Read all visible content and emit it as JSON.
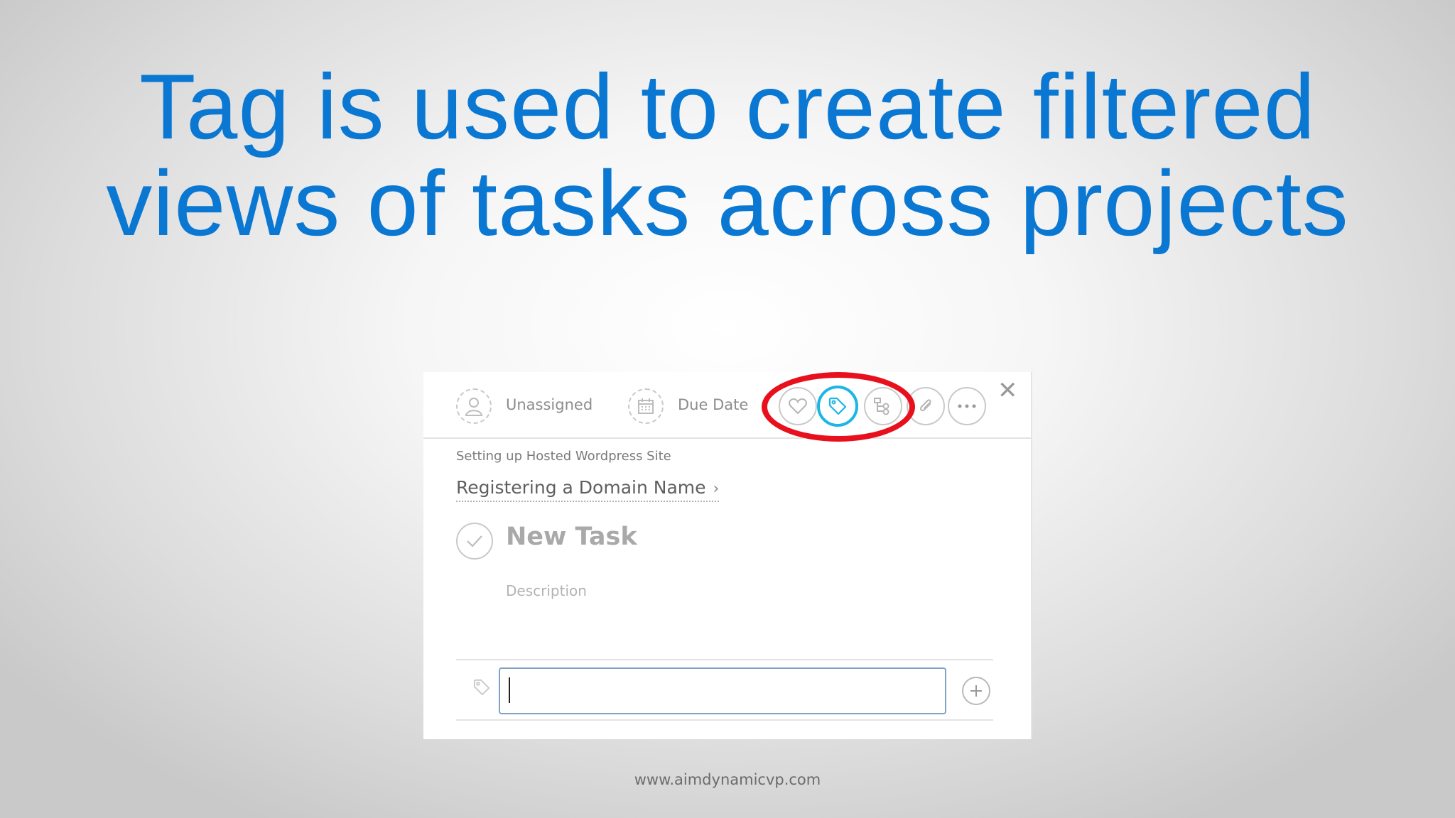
{
  "slide": {
    "title_line1": "Tag is used to create filtered",
    "title_line2": "views of tasks across projects",
    "footer": "www.aimdynamicvp.com"
  },
  "toolbar": {
    "assignee_label": "Unassigned",
    "due_date_label": "Due Date",
    "icons": [
      "user-icon",
      "calendar-icon",
      "heart-icon",
      "tag-icon",
      "subtask-icon",
      "attachment-icon",
      "more-icon",
      "close-icon"
    ],
    "highlight_color": "#e8101c",
    "active_icon_color": "#1bb6e6"
  },
  "task": {
    "project_name": "Setting up Hosted Wordpress Site",
    "parent_task": "Registering a Domain Name",
    "title": "New Task",
    "description_placeholder": "Description"
  },
  "tag_input": {
    "value": "",
    "placeholder": ""
  },
  "colors": {
    "title_blue": "#0a78d2"
  }
}
